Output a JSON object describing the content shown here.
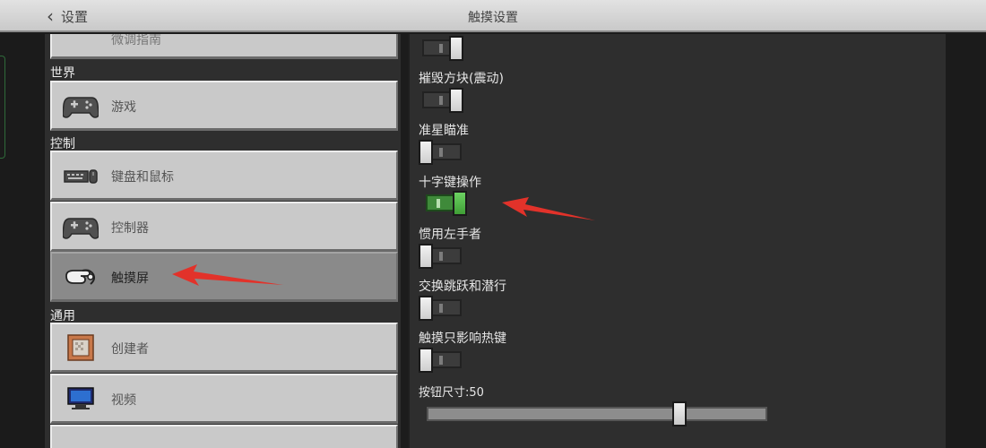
{
  "header": {
    "back_label": "设置",
    "title": "触摸设置"
  },
  "sidebar": {
    "partial_item_label": "微调指南",
    "sections": [
      {
        "label": "世界",
        "items": [
          {
            "label": "游戏",
            "icon": "gamepad-icon"
          }
        ]
      },
      {
        "label": "控制",
        "items": [
          {
            "label": "键盘和鼠标",
            "icon": "keyboard-mouse-icon"
          },
          {
            "label": "控制器",
            "icon": "controller-icon"
          },
          {
            "label": "触摸屏",
            "icon": "touch-hand-icon",
            "selected": true
          }
        ]
      },
      {
        "label": "通用",
        "items": [
          {
            "label": "创建者",
            "icon": "creator-block-icon"
          },
          {
            "label": "视频",
            "icon": "monitor-icon"
          }
        ]
      }
    ]
  },
  "settings": {
    "items": [
      {
        "label": "",
        "state": "partial"
      },
      {
        "label": "摧毁方块(震动)",
        "state": "partial"
      },
      {
        "label": "准星瞄准",
        "state": "off"
      },
      {
        "label": "十字键操作",
        "state": "on"
      },
      {
        "label": "惯用左手者",
        "state": "off"
      },
      {
        "label": "交换跳跃和潜行",
        "state": "off"
      },
      {
        "label": "触摸只影响热键",
        "state": "off"
      }
    ],
    "slider": {
      "label": "按钮尺寸:50",
      "value": 50
    }
  },
  "colors": {
    "toggle_on": "#3f9f36",
    "annotation_arrow": "#e2322a",
    "header_bg": "#d6d6d6",
    "panel_bg": "#2e2e2e"
  }
}
